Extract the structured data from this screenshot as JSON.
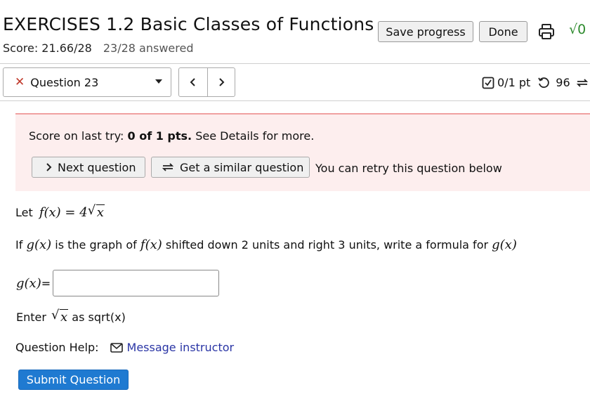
{
  "header": {
    "title": "EXERCISES 1.2 Basic Classes of Functions",
    "score_text": "Score: 21.66/28",
    "answered_text": "23/28 answered",
    "save_label": "Save progress",
    "done_label": "Done",
    "math_tool_label": "√0"
  },
  "question_nav": {
    "selected_question": "Question 23",
    "status_mark": "✕",
    "points": "0/1 pt",
    "tries_left": "96"
  },
  "alert": {
    "prefix": "Score on last try: ",
    "score_bold": "0 of 1 pts.",
    "suffix": " See Details for more.",
    "next_label": "Next question",
    "similar_label": "Get a similar question",
    "retry_text": "You can retry this question below"
  },
  "question": {
    "let_word": "Let",
    "f_def_lhs": "f(x) = 4",
    "f_def_rad": "x",
    "if_word": "If",
    "g_of_x": "g(x)",
    "is_graph_of": " is the graph of ",
    "f_of_x": "f(x)",
    "rest": " shifted down 2 units and right 3 units, write a formula for ",
    "g_of_x_end": "g(x)",
    "answer_label_math": "g(x)",
    "answer_label_eq": "=",
    "answer_value": "",
    "enter_word": "Enter",
    "enter_rad": "x",
    "enter_suffix": " as sqrt(x)"
  },
  "help": {
    "label": "Question Help:",
    "link_text": "Message instructor"
  },
  "submit_label": "Submit Question",
  "colors": {
    "accent": "#1f7ad1",
    "error": "#c0392b",
    "alert_bg": "#fdeeee",
    "link": "#2a35a5",
    "math_tool": "#2e8b2e"
  }
}
